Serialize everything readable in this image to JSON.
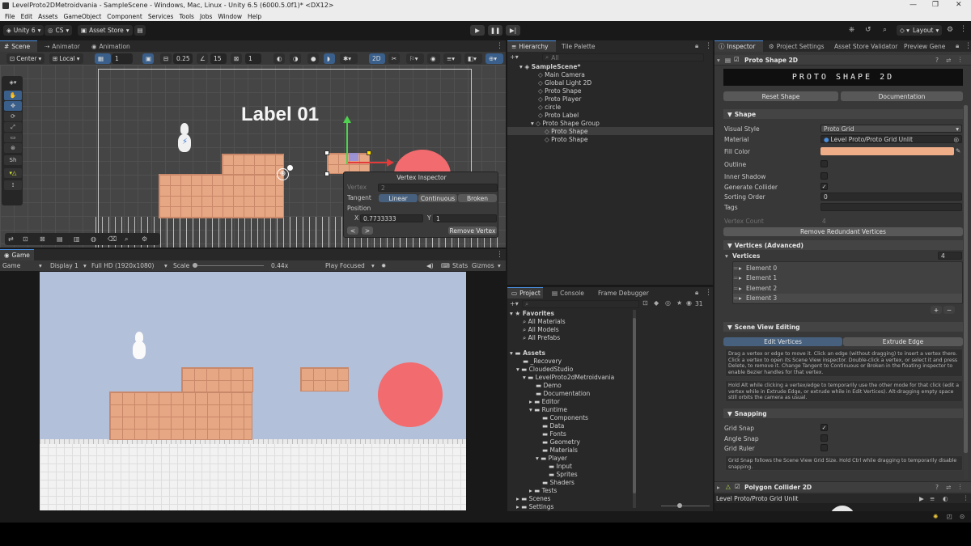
{
  "window": {
    "title": "LevelProto2DMetroidvania - SampleScene - Windows, Mac, Linux - Unity 6.5 (6000.5.0f1)* <DX12>"
  },
  "menu": [
    "File",
    "Edit",
    "Assets",
    "GameObject",
    "Component",
    "Services",
    "Tools",
    "Jobs",
    "Window",
    "Help"
  ],
  "toolbar": {
    "account": "Unity 6",
    "cs": "CS",
    "asset_store": "Asset Store",
    "layout": "Layout"
  },
  "scene_tabs": [
    "Scene",
    "Animator",
    "Animation"
  ],
  "scene_toolbar": {
    "pivot": "Center",
    "space": "Local",
    "grid_value": "1",
    "snap_value": "0.25",
    "angle_value": "15",
    "increment_value": "1",
    "mode_2d": "2D"
  },
  "tools": {
    "sh": "Sh"
  },
  "scene": {
    "label": "Label 01"
  },
  "vertex_inspector": {
    "title": "Vertex Inspector",
    "vertex_label": "Vertex",
    "vertex_value": "2",
    "tangent_label": "Tangent",
    "tangent_options": [
      "Linear",
      "Continuous",
      "Broken"
    ],
    "position_label": "Position",
    "x_label": "X",
    "x_value": "0.7733333",
    "y_label": "Y",
    "y_value": "1",
    "prev": "<",
    "next": ">",
    "remove": "Remove Vertex"
  },
  "game": {
    "tab": "Game",
    "display_select": "Game",
    "display": "Display 1",
    "resolution": "Full HD (1920x1080)",
    "scale_label": "Scale",
    "scale_value": "0.44x",
    "play_mode": "Play Focused",
    "stats": "Stats",
    "gizmos": "Gizmos"
  },
  "hierarchy": {
    "tabs": [
      "Hierarchy",
      "Tile Palette"
    ],
    "search_placeholder": "All",
    "scene": "SampleScene*",
    "items": [
      "Main Camera",
      "Global Light 2D",
      "Proto Shape",
      "Proto Player",
      "circle",
      "Proto Label",
      "Proto Shape Group",
      "Proto Shape",
      "Proto Shape"
    ]
  },
  "project": {
    "tabs": [
      "Project",
      "Console",
      "Frame Debugger"
    ],
    "count": "31",
    "favorites": "Favorites",
    "fav_items": [
      "All Materials",
      "All Models",
      "All Prefabs"
    ],
    "assets": "Assets",
    "tree": [
      "_Recovery",
      "CloudedStudio",
      "LevelProto2dMetroidvania",
      "Demo",
      "Documentation",
      "Editor",
      "Runtime",
      "Components",
      "Data",
      "Fonts",
      "Geometry",
      "Materials",
      "Player",
      "Input",
      "Sprites",
      "Shaders",
      "Tests",
      "Scenes",
      "Settings"
    ]
  },
  "inspector": {
    "tabs": [
      "Inspector",
      "Project Settings",
      "Asset Store Validator",
      "Preview Gene"
    ],
    "component": "Proto Shape 2D",
    "banner": "PROTO SHAPE 2D",
    "reset": "Reset Shape",
    "docs": "Documentation",
    "shape_section": "Shape",
    "visual_style_label": "Visual Style",
    "visual_style": "Proto Grid",
    "material_label": "Material",
    "material": "Level Proto/Proto Grid Unlit",
    "fill_color_label": "Fill Color",
    "fill_color": "#f0ae88",
    "outline_label": "Outline",
    "inner_shadow_label": "Inner Shadow",
    "gen_collider_label": "Generate Collider",
    "sorting_label": "Sorting Order",
    "sorting": "0",
    "tags_label": "Tags",
    "vertex_count_label": "Vertex Count",
    "vertex_count": "4",
    "remove_redundant": "Remove Redundant Vertices",
    "vertices_section": "Vertices (Advanced)",
    "vertices_label": "Vertices",
    "vertices_count": "4",
    "elements": [
      "Element 0",
      "Element 1",
      "Element 2",
      "Element 3"
    ],
    "add": "+",
    "remove": "−",
    "editing_section": "Scene View Editing",
    "edit_vertices": "Edit Vertices",
    "extrude_edge": "Extrude Edge",
    "help1": "Drag a vertex or edge to move it. Click an edge (without dragging) to insert a vertex there. Click a vertex to open its Scene View inspector. Double-click a vertex, or select it and press Delete, to remove it. Change Tangent to Continuous or Broken in the floating inspector to enable Bezier handles for that vertex.",
    "help2": "Hold Alt while clicking a vertex/edge to temporarily use the other mode for that click (edit a vertex while in Extrude Edge, or extrude while in Edit Vertices). Alt-dragging empty space still orbits the camera as usual.",
    "snapping_section": "Snapping",
    "grid_snap_label": "Grid Snap",
    "angle_snap_label": "Angle Snap",
    "grid_ruler_label": "Grid Ruler",
    "help3": "Grid Snap follows the Scene View Grid Size. Hold Ctrl while dragging to temporarily disable snapping.",
    "collider": "Polygon Collider 2D",
    "preview_label": "Level Proto/Proto Grid Unlit"
  },
  "colors": {
    "accent": "#4a8fe0",
    "tile": "#e6a784",
    "circle": "#f26b6e",
    "sky": "#b3c0d9"
  }
}
